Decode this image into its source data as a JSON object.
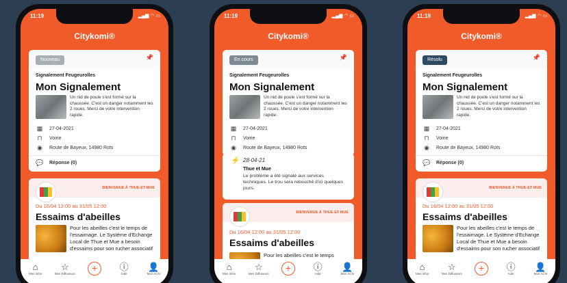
{
  "phones": [
    {
      "status_time": "11:19",
      "app_title": "Citykomi®",
      "report": {
        "status_tag": "Nouveau",
        "status_color": "#a8b0b6",
        "category": "Signalement Feugeurolles",
        "title": "Mon Signalement",
        "description": "Un nid de poule s'est formé sur la chaussée. C'est un danger notamment les 2 roues. Merci de votre intervention rapide.",
        "date": "27-04-2021",
        "type": "Voirie",
        "address": "Route de Bayeux, 14980 Rots",
        "reply_label": "Réponse (0)"
      },
      "news": {
        "welcome": "BIENVENUE À THUE-ET-MUE",
        "date_range": "Du 16/04 12:00 au 31/05 12:00",
        "title": "Essaims d'abeilles",
        "text": "Pour les abeilles c'est le temps de l'essaimage. Le Système d'Echange Local de Thue et Mue a besoin d'essaims pour son rucher associatif"
      }
    },
    {
      "status_time": "11:19",
      "app_title": "Citykomi®",
      "report": {
        "status_tag": "En cours",
        "status_color": "#7b8a95",
        "category": "Signalement Feugeurolles",
        "title": "Mon Signalement",
        "description": "Un nid de poule s'est formé sur la chaussée. C'est un danger notamment les 2 roues. Merci de votre intervention rapide.",
        "date": "27-04-2021",
        "type": "Voirie",
        "address": "Route de Bayeux, 14980 Rots"
      },
      "response": {
        "date": "28-04-21",
        "author": "Thue et Mue",
        "text": "Le problème a été signalé aux services techniques. Le trou sera rebouché d'ici quelques jours."
      },
      "news": {
        "welcome": "BIENVENUE À THUE-ET-MUE",
        "date_range": "Du 16/04 12:00 au 31/05 12:00",
        "title": "Essaims d'abeilles",
        "text": "Pour les abeilles c'est le temps"
      }
    },
    {
      "status_time": "11:19",
      "app_title": "Citykomi®",
      "report": {
        "status_tag": "Résolu",
        "status_color": "#2e4a62",
        "category": "Signalement Feugeurolles",
        "title": "Mon Signalement",
        "description": "Un nid de poule s'est formé sur la chaussée. C'est un danger notamment les 2 roues. Merci de votre intervention rapide.",
        "date": "27-04-2021",
        "type": "Voirie",
        "address": "Route de Bayeux, 14980 Rots",
        "reply_label": "Réponse (0)"
      },
      "news": {
        "welcome": "BIENVENUE À THUE-ET-MUE",
        "date_range": "Du 16/04 12:00 au 31/05 12:00",
        "title": "Essaims d'abeilles",
        "text": "Pour les abeilles c'est le temps de l'essaimage. Le Système d'Echange Local de Thue et Mue a besoin d'essaims pour son rucher associatif"
      }
    }
  ],
  "tabbar": [
    {
      "label": "Mes infos",
      "icon": "home-icon"
    },
    {
      "label": "Mes Diffuseurs",
      "icon": "star-icon"
    },
    {
      "label": "",
      "icon": "plus-icon"
    },
    {
      "label": "Aide",
      "icon": "help-icon"
    },
    {
      "label": "Mon ACN",
      "icon": "account-icon"
    }
  ],
  "colors": {
    "accent": "#f15a29",
    "background": "#2b3e52",
    "tab_icon": "#1f3a5f"
  }
}
